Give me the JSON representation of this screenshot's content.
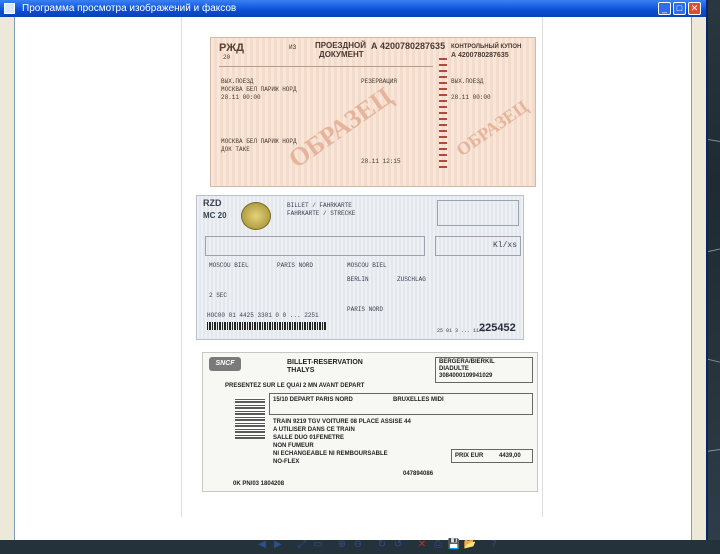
{
  "window": {
    "title": "Программа просмотра изображений и факсов",
    "buttons": {
      "minimize": "_",
      "maximize": "□",
      "close": "✕"
    }
  },
  "ticket_rzd": {
    "header_left": "РЖД",
    "header_left_sub": "20",
    "header_mid": "ИЗ",
    "doc_title_1": "ПРОЕЗДНОЙ",
    "doc_title_2": "ДОКУМЕНТ",
    "serial": "А 4200780287635",
    "control_title": "КОНТРОЛЬНЫЙ КУПОН",
    "control_serial": "А 4200780287635",
    "line_1": "ВЫХ.ПОЕЗД",
    "line_2": "МОСКВА БЕЛ ПАРИЖ НОРД",
    "line_3": "28.11 00:00",
    "line_4": "МОСКВА БЕЛ ПАРИЖ НОРД",
    "line_5": "ДОК ТАКЕ",
    "line_6": "РЕЗЕРВАЦИЯ",
    "line_7": "28.11 12:15",
    "watermark": "ОБРАЗЕЦ",
    "watermark_2": "ОБРАЗЕЦ"
  },
  "ticket_rzd_euro": {
    "header": "RZD",
    "subheader": "MC 20",
    "doc_title": "BILLET / FAHRKARTE",
    "doc_subtitle": "FAHRKARTE / STRECKE",
    "line_1": "MOSCOU BIEL",
    "line_2": "PARIS NORD",
    "line_3": "2 SEC",
    "line_4": "MOSCOU BIEL",
    "line_5": "BERLIN",
    "line_6": "ZUSCHLAG",
    "line_7": "PARIS NORD",
    "footer_code": "HOC00 01 4425 3301 0 0 ... 2251",
    "number": "225452",
    "number_prefix": "25 01 3 ... 11/0"
  },
  "ticket_sncf": {
    "brand": "SNCF",
    "title": "BILLET-RESERVATION",
    "subtitle": "THALYS",
    "box_title": "BERGERA/BIERKIL",
    "box_sub": "DIADULTE",
    "box_code": "3084000109941029",
    "line_1": "PRESENTEZ SUR LE QUAI 2 MN AVANT DEPART",
    "line_2": "15/10 DEPART PARIS NORD",
    "line_3": "BRUXELLES MIDI",
    "line_4": "TRAIN 9219 TGV VOITURE 08 PLACE ASSISE 44",
    "line_5": "A UTILISER DANS CE TRAIN",
    "line_6": "SALLE DUO 01FENETRE",
    "line_7": "NON FUMEUR",
    "line_8": "NI ECHANGEABLE NI REMBOURSABLE",
    "line_9": "NO-FLEX",
    "price_label": "PRIX EUR",
    "price": "4439,00",
    "ref": "047894086",
    "footer": "0K PN/03 1804208"
  },
  "toolbar": {
    "prev": "◀",
    "next": "▶",
    "fit": "⤢",
    "actual": "▭",
    "zoom_in": "⊕",
    "zoom_out": "⊖",
    "rotate_cw": "↻",
    "rotate_ccw": "↺",
    "delete": "✕",
    "print": "⎙",
    "save": "💾",
    "open": "📂",
    "help": "?"
  }
}
